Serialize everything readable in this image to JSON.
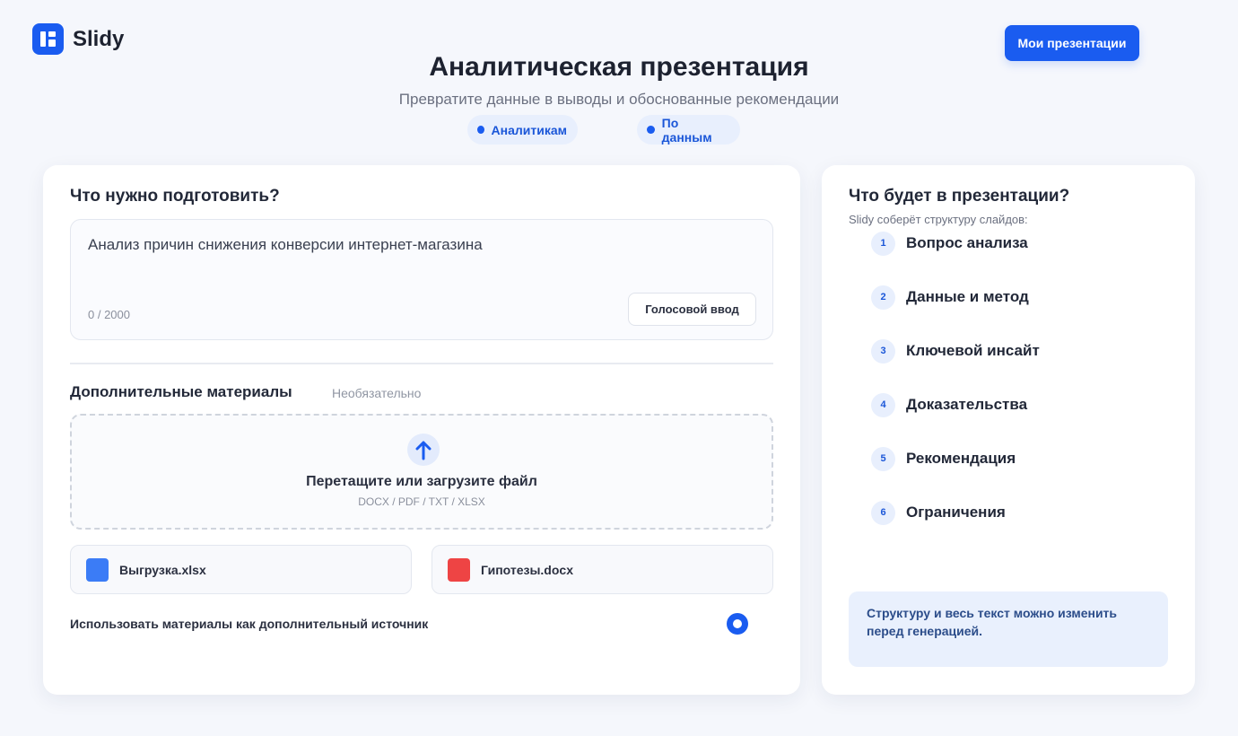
{
  "app": {
    "name": "Slidy"
  },
  "header": {
    "my_presentations_label": "Мои презентации"
  },
  "hero": {
    "title": "Аналитическая презентация",
    "subtitle": "Превратите данные в выводы и обоснованные рекомендации",
    "chips": [
      "Аналитикам",
      "По данным"
    ]
  },
  "prompt": {
    "section_title": "Что нужно подготовить?",
    "text": "Анализ причин снижения конверсии интернет-магазина",
    "counter": "0 / 2000",
    "voice_button_label": "Голосовой ввод"
  },
  "materials": {
    "title": "Дополнительные материалы",
    "optional_label": "Необязательно",
    "dropzone_title": "Перетащите или загрузите файл",
    "dropzone_formats": "DOCX / PDF / TXT / XLSX",
    "files": [
      {
        "name": "Выгрузка.xlsx",
        "color": "#3b7cf6"
      },
      {
        "name": "Гипотезы.docx",
        "color": "#ee4444"
      }
    ],
    "use_as_source_label": "Использовать материалы как дополнительный источник",
    "use_as_source_selected": true
  },
  "structure": {
    "title": "Что будет в презентации?",
    "subtitle": "Slidy соберёт структуру слайдов:",
    "steps": [
      {
        "num": "1",
        "label": "Вопрос анализа"
      },
      {
        "num": "2",
        "label": "Данные и метод"
      },
      {
        "num": "3",
        "label": "Ключевой инсайт"
      },
      {
        "num": "4",
        "label": "Доказательства"
      },
      {
        "num": "5",
        "label": "Рекомендация"
      },
      {
        "num": "6",
        "label": "Ограничения"
      }
    ],
    "note": "Структуру и весь текст можно изменить перед генерацией."
  },
  "colors": {
    "accent": "#1a5cf0",
    "background": "#f5f7fc"
  }
}
